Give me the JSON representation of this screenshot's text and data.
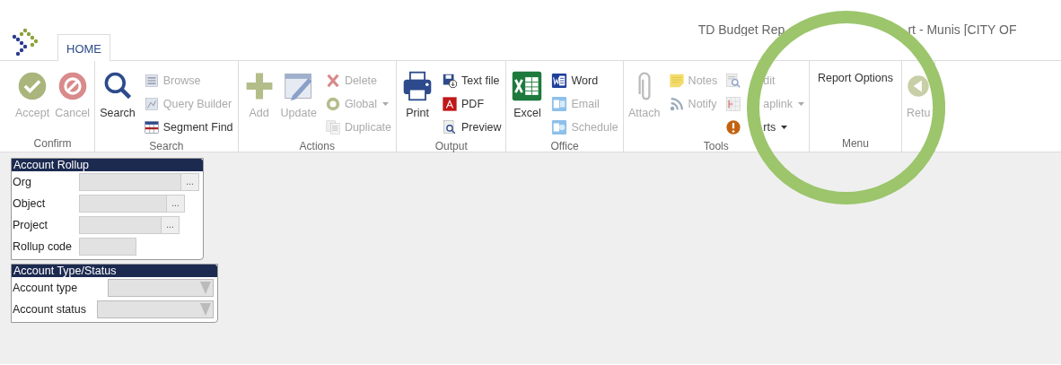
{
  "window": {
    "title_parts": [
      "TD Budget Rep",
      "rt - Munis [CITY OF"
    ]
  },
  "tabs": [
    {
      "label": "HOME",
      "selected": true
    }
  ],
  "ribbon": {
    "groups": [
      {
        "label": "Confirm",
        "items": [
          {
            "kind": "large",
            "label": "Accept",
            "disabled": true
          },
          {
            "kind": "large",
            "label": "Cancel",
            "disabled": true
          }
        ]
      },
      {
        "label": "Search",
        "items": [
          {
            "kind": "large",
            "label": "Search",
            "disabled": false
          },
          {
            "kind": "stack",
            "items": [
              {
                "label": "Browse",
                "disabled": true
              },
              {
                "label": "Query Builder",
                "disabled": true
              },
              {
                "label": "Segment Find",
                "disabled": false
              }
            ]
          }
        ]
      },
      {
        "label": "Actions",
        "items": [
          {
            "kind": "large",
            "label": "Add",
            "disabled": true
          },
          {
            "kind": "large",
            "label": "Update",
            "disabled": true
          },
          {
            "kind": "stack",
            "items": [
              {
                "label": "Delete",
                "disabled": true
              },
              {
                "label": "Global",
                "disabled": true,
                "dropdown": true
              },
              {
                "label": "Duplicate",
                "disabled": true
              }
            ]
          }
        ]
      },
      {
        "label": "Output",
        "items": [
          {
            "kind": "large",
            "label": "Print",
            "disabled": false
          },
          {
            "kind": "stack",
            "items": [
              {
                "label": "Text file",
                "disabled": false
              },
              {
                "label": "PDF",
                "disabled": false
              },
              {
                "label": "Preview",
                "disabled": false
              }
            ]
          }
        ]
      },
      {
        "label": "Office",
        "items": [
          {
            "kind": "large",
            "label": "Excel",
            "disabled": false
          },
          {
            "kind": "stack",
            "items": [
              {
                "label": "Word",
                "disabled": false
              },
              {
                "label": "Email",
                "disabled": true
              },
              {
                "label": "Schedule",
                "disabled": true
              }
            ]
          }
        ]
      },
      {
        "label": "Tools",
        "items": [
          {
            "kind": "large",
            "label": "Attach",
            "disabled": true
          },
          {
            "kind": "stack",
            "items": [
              {
                "label": "Notes",
                "disabled": true
              },
              {
                "label": "Notify",
                "disabled": true
              }
            ]
          },
          {
            "kind": "stack",
            "items": [
              {
                "label": "dit",
                "disabled": true,
                "partly_covered": true
              },
              {
                "label": "aplink",
                "disabled": true,
                "dropdown": true,
                "partly_covered": true
              },
              {
                "label": "rts",
                "disabled": false,
                "dropdown": true,
                "partly_covered": true
              }
            ]
          }
        ]
      },
      {
        "label": "Menu",
        "items": [
          {
            "kind": "text",
            "label": "Report Options",
            "disabled": false
          }
        ]
      },
      {
        "items": [
          {
            "kind": "large",
            "label": "Retu",
            "disabled": true
          }
        ]
      }
    ]
  },
  "panels": [
    {
      "title": "Account Rollup",
      "fields": [
        {
          "label": "Org",
          "kind": "lookup",
          "disabled": true,
          "button_label": "..."
        },
        {
          "label": "Object",
          "kind": "lookup",
          "disabled": true,
          "button_label": "..."
        },
        {
          "label": "Project",
          "kind": "lookup",
          "disabled": true,
          "button_label": "..."
        },
        {
          "label": "Rollup code",
          "kind": "text",
          "disabled": true
        }
      ]
    },
    {
      "title": "Account Type/Status",
      "fields": [
        {
          "label": "Account type",
          "kind": "select",
          "disabled": true
        },
        {
          "label": "Account status",
          "kind": "select",
          "disabled": true
        }
      ]
    }
  ]
}
